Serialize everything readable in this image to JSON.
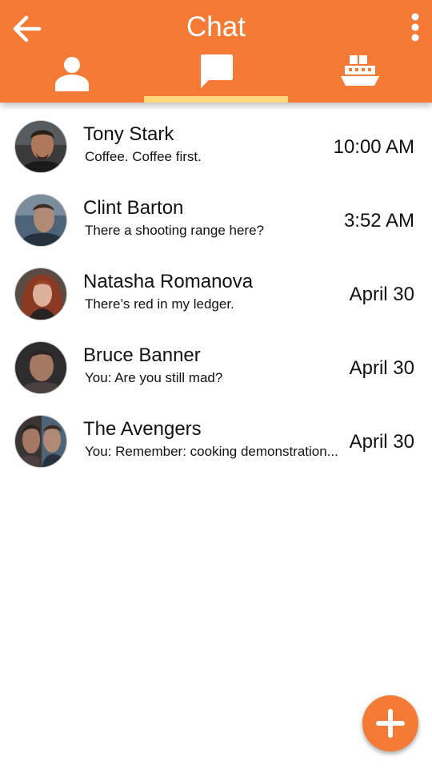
{
  "header": {
    "title": "Chat",
    "background_color": "#F47A36",
    "tab_indicator_color": "#FDD77A",
    "back_icon": "arrow-left-icon",
    "menu_icon": "more-vert-icon"
  },
  "tabs": [
    {
      "icon": "person-icon",
      "selected": false
    },
    {
      "icon": "chat-bubble-icon",
      "selected": true
    },
    {
      "icon": "ship-icon",
      "selected": false
    }
  ],
  "chats": [
    {
      "name": "Tony Stark",
      "preview": "Coffee. Coffee first.",
      "time": "10:00 AM"
    },
    {
      "name": "Clint Barton",
      "preview": "There a shooting range here?",
      "time": "3:52 AM"
    },
    {
      "name": "Natasha Romanova",
      "preview": "There’s red in my ledger.",
      "time": "April 30"
    },
    {
      "name": "Bruce Banner",
      "preview": "You: Are you still mad?",
      "time": "April 30"
    },
    {
      "name": "The Avengers",
      "preview": "You: Remember: cooking demonstration...",
      "time": "April 30"
    }
  ],
  "fab": {
    "icon": "plus-icon"
  }
}
